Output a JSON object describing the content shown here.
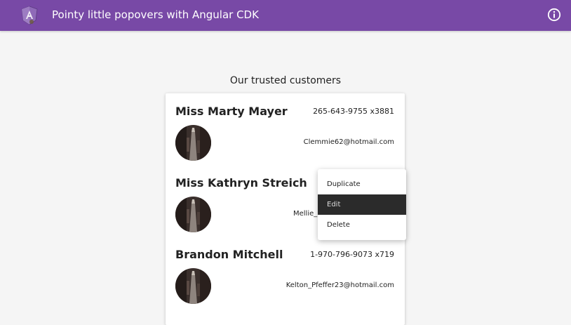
{
  "app": {
    "title": "Pointy little popovers with Angular CDK",
    "logo_icon": "angular-logo-icon",
    "info_icon": "info-icon",
    "brand_color": "#7849a6"
  },
  "main": {
    "heading": "Our trusted customers"
  },
  "customers": [
    {
      "name": "Miss Marty Mayer",
      "phone": "265-643-9755 x3881",
      "email": "Clemmie62@hotmail.com"
    },
    {
      "name": "Miss Kathryn Streich",
      "phone": "",
      "email": "Mellie_"
    },
    {
      "name": "Brandon Mitchell",
      "phone": "1-970-796-9073 x719",
      "email": "Kelton_Pfeffer23@hotmail.com"
    }
  ],
  "context_menu": {
    "items": [
      {
        "label": "Duplicate"
      },
      {
        "label": "Edit"
      },
      {
        "label": "Delete"
      }
    ],
    "active_item": "Edit"
  }
}
